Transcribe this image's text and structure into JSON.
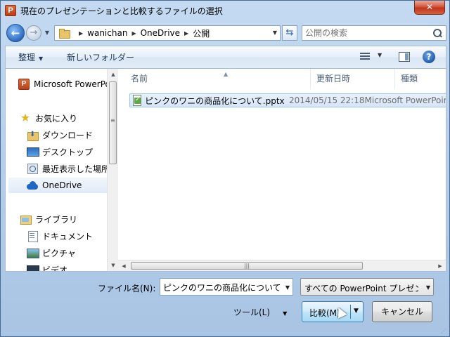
{
  "window": {
    "title": "現在のプレゼンテーションと比較するファイルの選択",
    "app_icon_letter": "P",
    "close_label": "✕"
  },
  "address": {
    "path": [
      "wanichan",
      "OneDrive",
      "公開"
    ],
    "search_placeholder": "公開の検索"
  },
  "toolbar": {
    "organize_label": "整理",
    "new_folder_label": "新しいフォルダー"
  },
  "navpane": {
    "items": [
      {
        "label": "Microsoft PowerPoint",
        "icon": "powerpoint-icon"
      },
      {
        "label": "お気に入り",
        "icon": "star-icon"
      },
      {
        "label": "ダウンロード",
        "icon": "download-folder-icon"
      },
      {
        "label": "デスクトップ",
        "icon": "desktop-icon"
      },
      {
        "label": "最近表示した場所",
        "icon": "recent-places-icon"
      },
      {
        "label": "OneDrive",
        "icon": "onedrive-icon"
      },
      {
        "label": "ライブラリ",
        "icon": "library-icon"
      },
      {
        "label": "ドキュメント",
        "icon": "documents-icon"
      },
      {
        "label": "ピクチャ",
        "icon": "pictures-icon"
      },
      {
        "label": "ビデオ",
        "icon": "videos-icon"
      }
    ],
    "selected": "OneDrive"
  },
  "filelist": {
    "columns": [
      "名前",
      "更新日時",
      "種類"
    ],
    "rows": [
      {
        "name": "ピンクのワニの商品化について.pptx",
        "modified": "2014/05/15 22:18",
        "type": "Microsoft PowerPoint"
      }
    ]
  },
  "footer": {
    "filename_label": "ファイル名(N):",
    "filename_value": "ピンクのワニの商品化について",
    "filetype_value": "すべての PowerPoint プレゼンテーション",
    "tools_label": "ツール(L)",
    "compare_label": "比較(M)",
    "cancel_label": "キャンセル"
  }
}
